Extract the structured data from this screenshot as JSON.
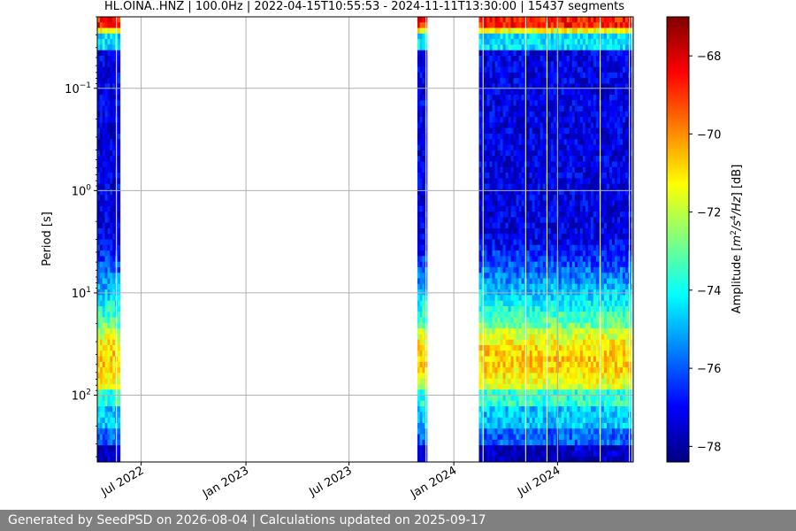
{
  "chart_data": {
    "type": "heatmap",
    "title": "HL.OINA..HNZ | 100.0Hz | 2022-04-15T10:55:53 - 2024-11-11T13:30:00 | 15437 segments",
    "xlabel": "",
    "ylabel": "Period [s]",
    "colorbar_label": "Amplitude [m²/s⁴/Hz] [dB]",
    "colorbar_label_parts": {
      "prefix": "Amplitude [",
      "m": "m",
      "two": "2",
      "s": "/s",
      "four": "4",
      "hz": "/Hz",
      "suffix": "] [dB]"
    },
    "x_tick_labels": [
      "Jul 2022",
      "Jan 2023",
      "Jul 2023",
      "Jan 2024",
      "Jul 2024"
    ],
    "x_ticks": [
      "2022-07-01",
      "2023-01-01",
      "2023-07-01",
      "2024-01-01",
      "2024-07-01"
    ],
    "xlim": [
      "2022-04-15",
      "2024-11-11"
    ],
    "y_scale": "log",
    "y_ticks": [
      0.1,
      1,
      10,
      100
    ],
    "y_tick_labels": [
      {
        "base": "10",
        "exp": "−1"
      },
      {
        "base": "10",
        "exp": "0"
      },
      {
        "base": "10",
        "exp": "1"
      },
      {
        "base": "10",
        "exp": "2"
      }
    ],
    "ylim": [
      0.02,
      450
    ],
    "y_inverted": true,
    "colorbar_range": [
      -78.4,
      -67.0
    ],
    "colorbar_ticks": [
      -68,
      -70,
      -72,
      -74,
      -76,
      -78
    ],
    "colorbar_tick_labels": [
      "−68",
      "−70",
      "−72",
      "−74",
      "−76",
      "−78"
    ],
    "colormap": "jet",
    "grid": true,
    "data_coverage": [
      {
        "start": "2022-04-15",
        "end": "2022-05-25"
      },
      {
        "start": "2023-10-29",
        "end": "2023-11-15"
      },
      {
        "start": "2024-02-14",
        "end": "2024-11-11"
      }
    ]
  },
  "footer": {
    "text": "Generated by SeedPSD on 2026-08-04 | Calculations updated on 2025-09-17"
  }
}
